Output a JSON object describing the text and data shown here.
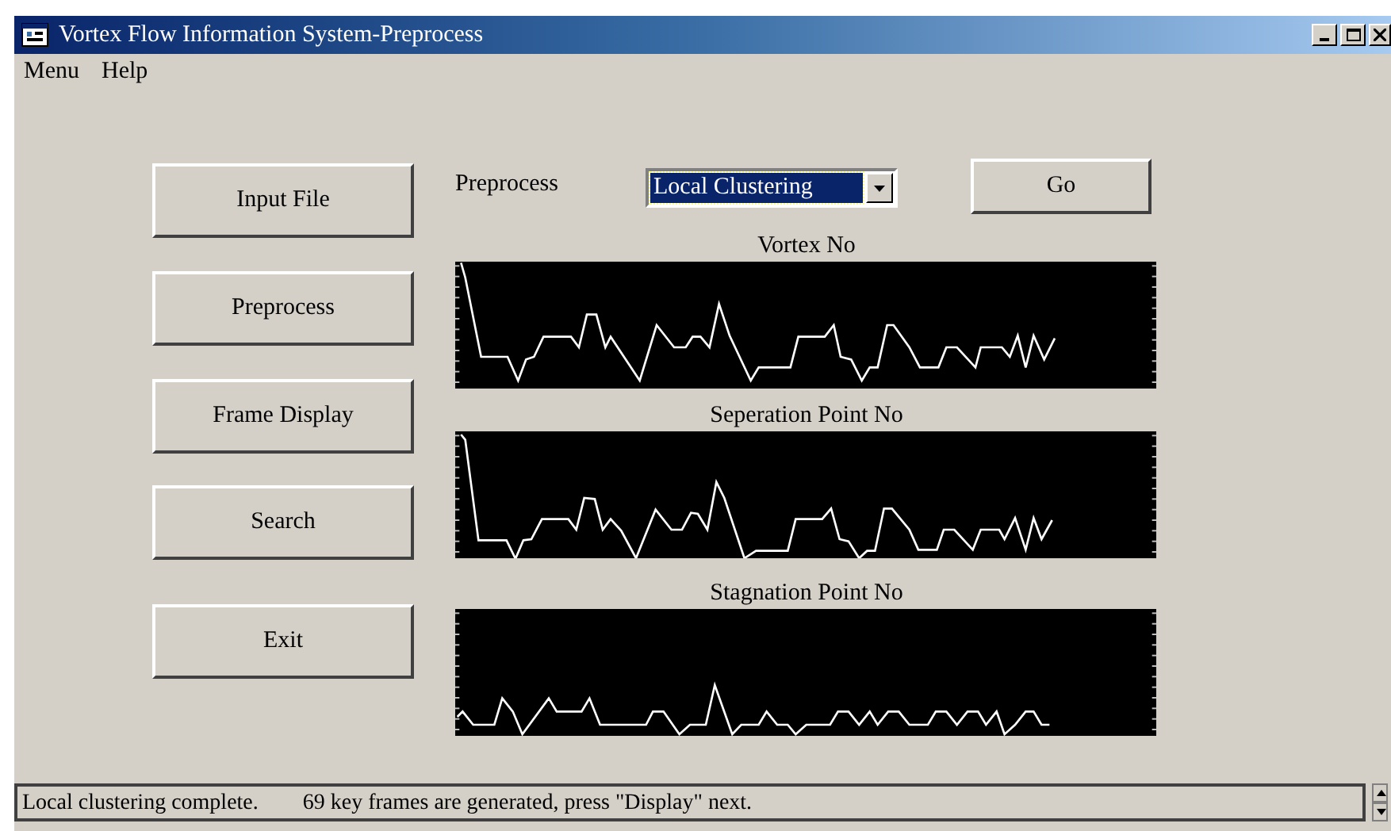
{
  "window": {
    "title": "Vortex Flow Information System-Preprocess"
  },
  "menu": [
    "Menu",
    "Help"
  ],
  "buttons": [
    "Input File",
    "Preprocess",
    "Frame Display",
    "Search",
    "Exit"
  ],
  "preprocess": {
    "label": "Preprocess",
    "dropdown": "Local Clustering",
    "go": "Go"
  },
  "charts": [
    {
      "title": "Vortex No"
    },
    {
      "title": "Seperation Point No"
    },
    {
      "title": "Stagnation Point No"
    }
  ],
  "status_bar": {
    "message": "Local clustering complete.",
    "detail": "69  key frames are generated, press \"Display\" next."
  }
}
